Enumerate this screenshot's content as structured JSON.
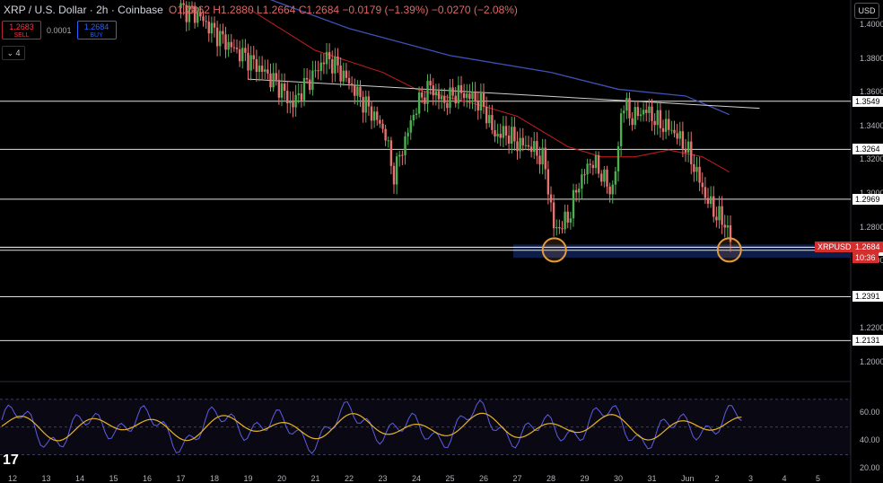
{
  "header": {
    "symbol_title": "XRP / U.S. Dollar · 2h · Coinbase",
    "ohlc": {
      "o": "O1.2862",
      "h": "H1.2880",
      "l": "L1.2664",
      "c": "C1.2684",
      "chg": "−0.0179 (−1.39%)",
      "chg2": "−0.0270 (−2.08%)"
    }
  },
  "trade_panel": {
    "sell_price": "1.2683",
    "sell_label": "SELL",
    "spread": "0.0001",
    "buy_price": "1.2684",
    "buy_label": "BUY",
    "indicators_count": "4"
  },
  "currency": "USD",
  "colors": {
    "bull": "#26a69a",
    "bear": "#ef5350",
    "candle_up": "#4caf50",
    "candle_down": "#e57373",
    "ma_slow": "#3f51b5",
    "ma_fast": "#b71c1c",
    "support_zone": "#0d1d4a",
    "rsi": "#5e5ce6",
    "rsi_ma": "#e6b422"
  },
  "chart_data": {
    "type": "candlestick",
    "price_axis": {
      "ticks": [
        "1.4000",
        "1.3800",
        "1.3600",
        "1.3400",
        "1.3200",
        "1.3000",
        "1.2800",
        "1.2600",
        "1.2400",
        "1.2200",
        "1.2000"
      ],
      "range": [
        1.18,
        1.41
      ]
    },
    "x_ticks": [
      "12",
      "13",
      "14",
      "15",
      "16",
      "17",
      "18",
      "19",
      "20",
      "21",
      "22",
      "23",
      "24",
      "25",
      "26",
      "27",
      "28",
      "29",
      "30",
      "31",
      "Jun",
      "2",
      "3",
      "4",
      "5"
    ],
    "levels": [
      1.3549,
      1.3264,
      1.2969,
      1.2666,
      1.2391,
      1.2131
    ],
    "level_labels": [
      "1.3549",
      "1.3264",
      "1.2969",
      "1.2666",
      "1.2391",
      "1.2131"
    ],
    "current_price": "1.2684",
    "current_symbol": "XRPUSD",
    "countdown": "10:36",
    "trendline": [
      [
        19.0,
        1.368
      ],
      [
        30.0,
        1.3555
      ]
    ],
    "support_zone": [
      1.2665,
      1.27
    ],
    "price_path": [
      [
        17.0,
        1.41
      ],
      [
        17.5,
        1.406
      ],
      [
        18.0,
        1.396
      ],
      [
        18.5,
        1.387
      ],
      [
        19.0,
        1.38
      ],
      [
        19.5,
        1.372
      ],
      [
        20.0,
        1.362
      ],
      [
        20.3,
        1.352
      ],
      [
        20.6,
        1.362
      ],
      [
        21.0,
        1.372
      ],
      [
        21.3,
        1.381
      ],
      [
        21.6,
        1.376
      ],
      [
        22.0,
        1.366
      ],
      [
        22.4,
        1.355
      ],
      [
        22.8,
        1.345
      ],
      [
        23.1,
        1.335
      ],
      [
        23.3,
        1.31
      ],
      [
        23.6,
        1.328
      ],
      [
        24.0,
        1.352
      ],
      [
        24.4,
        1.364
      ],
      [
        24.8,
        1.354
      ],
      [
        25.2,
        1.36
      ],
      [
        25.6,
        1.358
      ],
      [
        26.0,
        1.352
      ],
      [
        26.3,
        1.335
      ],
      [
        26.7,
        1.336
      ],
      [
        27.0,
        1.33
      ],
      [
        27.4,
        1.328
      ],
      [
        27.8,
        1.32
      ],
      [
        28.1,
        1.278
      ],
      [
        28.5,
        1.285
      ],
      [
        28.8,
        1.305
      ],
      [
        29.2,
        1.32
      ],
      [
        29.5,
        1.312
      ],
      [
        29.8,
        1.3
      ],
      [
        30.0,
        1.325
      ],
      [
        30.1,
        1.355
      ],
      [
        30.4,
        1.345
      ],
      [
        30.8,
        1.35
      ],
      [
        31.2,
        1.342
      ],
      [
        31.6,
        1.338
      ],
      [
        32.0,
        1.328
      ],
      [
        32.3,
        1.314
      ],
      [
        32.6,
        1.298
      ],
      [
        32.9,
        1.288
      ],
      [
        33.2,
        1.282
      ],
      [
        33.4,
        1.268
      ]
    ],
    "ma_slow": [
      [
        19.0,
        1.42
      ],
      [
        22.0,
        1.398
      ],
      [
        25.0,
        1.382
      ],
      [
        28.0,
        1.372
      ],
      [
        30.0,
        1.362
      ],
      [
        32.0,
        1.358
      ],
      [
        33.3,
        1.347
      ]
    ],
    "ma_fast": [
      [
        19.0,
        1.41
      ],
      [
        21.0,
        1.385
      ],
      [
        23.0,
        1.372
      ],
      [
        24.0,
        1.362
      ],
      [
        26.0,
        1.352
      ],
      [
        27.0,
        1.346
      ],
      [
        28.5,
        1.328
      ],
      [
        29.5,
        1.322
      ],
      [
        30.5,
        1.322
      ],
      [
        31.5,
        1.326
      ],
      [
        32.5,
        1.322
      ],
      [
        33.3,
        1.313
      ]
    ],
    "highlights": [
      28.1,
      33.3
    ],
    "rsi": {
      "ticks": [
        "60.00",
        "40.00",
        "20.00"
      ],
      "range": [
        20,
        75
      ]
    }
  }
}
